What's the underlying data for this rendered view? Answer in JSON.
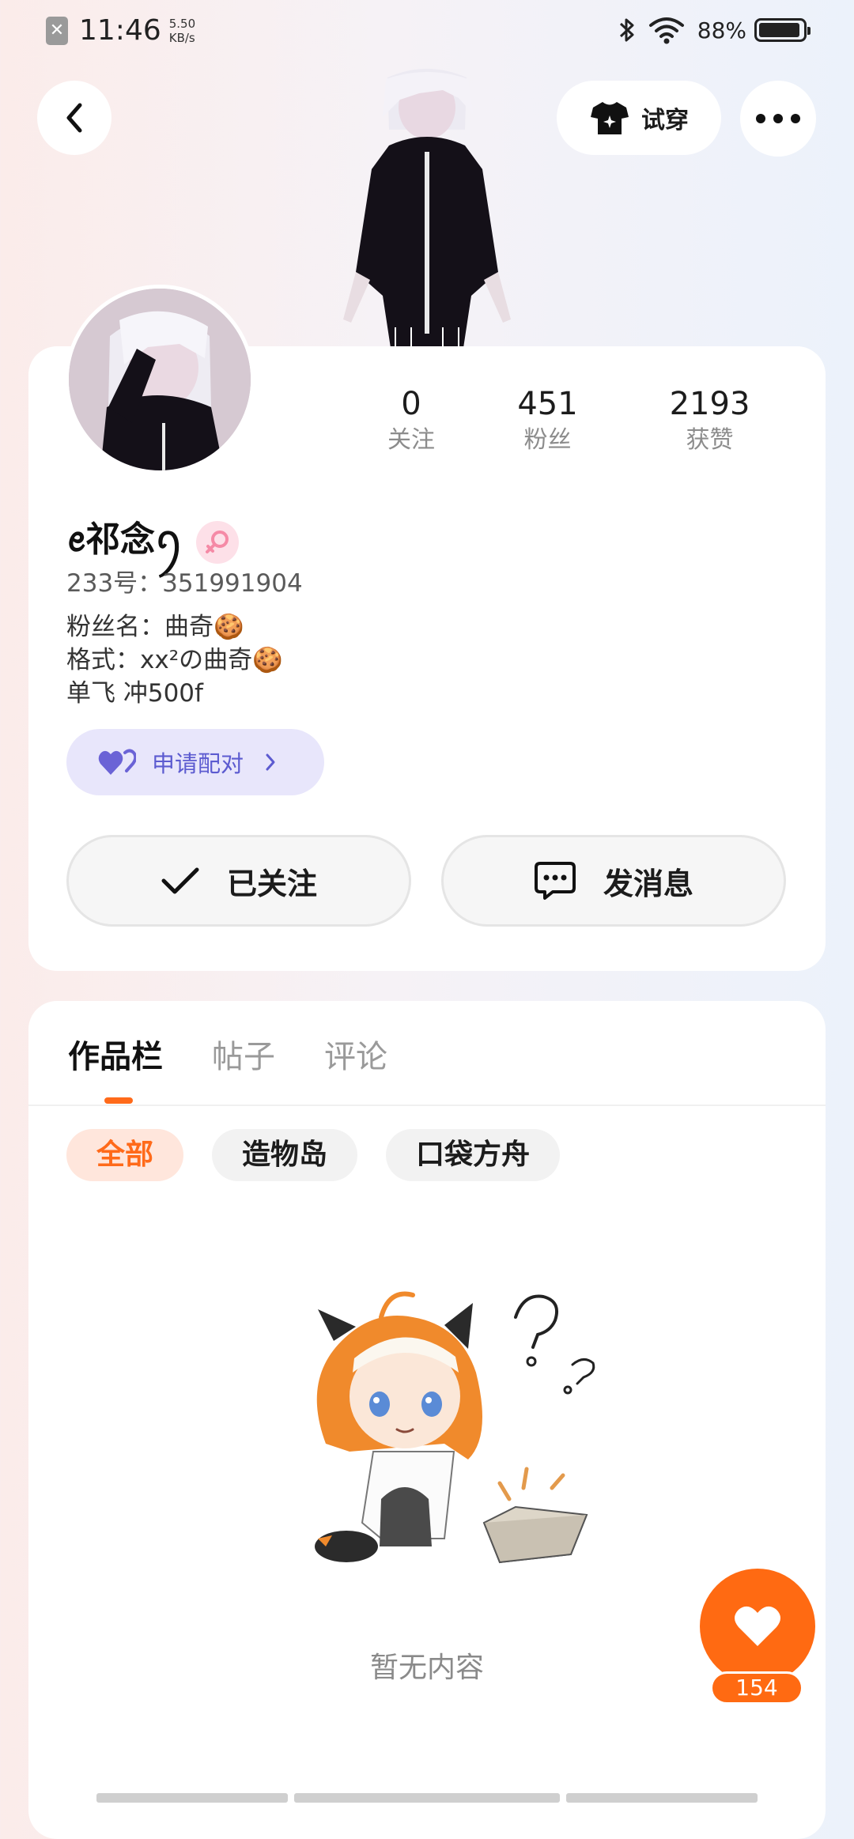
{
  "status_bar": {
    "time": "11:46",
    "net_speed_value": "5.50",
    "net_speed_unit": "KB/s",
    "battery": "88%"
  },
  "header": {
    "tryon_label": "试穿"
  },
  "profile": {
    "stats": [
      {
        "value": "0",
        "label": "关注"
      },
      {
        "value": "451",
        "label": "粉丝"
      },
      {
        "value": "2193",
        "label": "获赞"
      }
    ],
    "name": "ꫀ祁念ꪆ",
    "uid": "233号：351991904",
    "bio": [
      "粉丝名：曲奇🍪",
      "格式：xx²の曲奇🍪",
      "单飞 冲500f"
    ],
    "pair_label": "申请配对",
    "followed_label": "已关注",
    "message_label": "发消息"
  },
  "content": {
    "tabs": [
      "作品栏",
      "帖子",
      "评论"
    ],
    "chips": [
      "全部",
      "造物岛",
      "口袋方舟"
    ],
    "empty_text": "暂无内容"
  },
  "like": {
    "count": "154"
  },
  "colors": {
    "accent": "#ff6a12",
    "pair": "#5c5bd0",
    "gender": "#f58aa6"
  }
}
